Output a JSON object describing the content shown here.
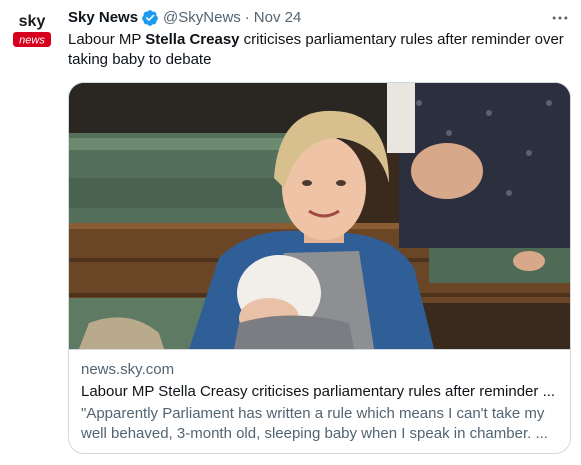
{
  "author": {
    "avatar_text_top": "sky",
    "avatar_text_bottom": "news",
    "name": "Sky News",
    "handle": "@SkyNews",
    "separator": "·",
    "time": "Nov 24",
    "verified": true
  },
  "tweet": {
    "text_before": "Labour MP ",
    "text_bold": "Stella Creasy",
    "text_after": " criticises parliamentary rules after reminder over taking baby to debate"
  },
  "card": {
    "domain": "news.sky.com",
    "title": "Labour MP Stella Creasy criticises parliamentary rules after reminder ...",
    "description": "\"Apparently Parliament has written a rule which means I can't take my well behaved, 3-month old, sleeping baby when I speak in chamber. ..."
  },
  "icons": {
    "more": "more-options-icon",
    "verified": "verified-badge-icon"
  },
  "colors": {
    "verified": "#1d9bf0",
    "sky_red": "#d6001c",
    "secondary_text": "#536471",
    "border": "#cfd9de"
  }
}
